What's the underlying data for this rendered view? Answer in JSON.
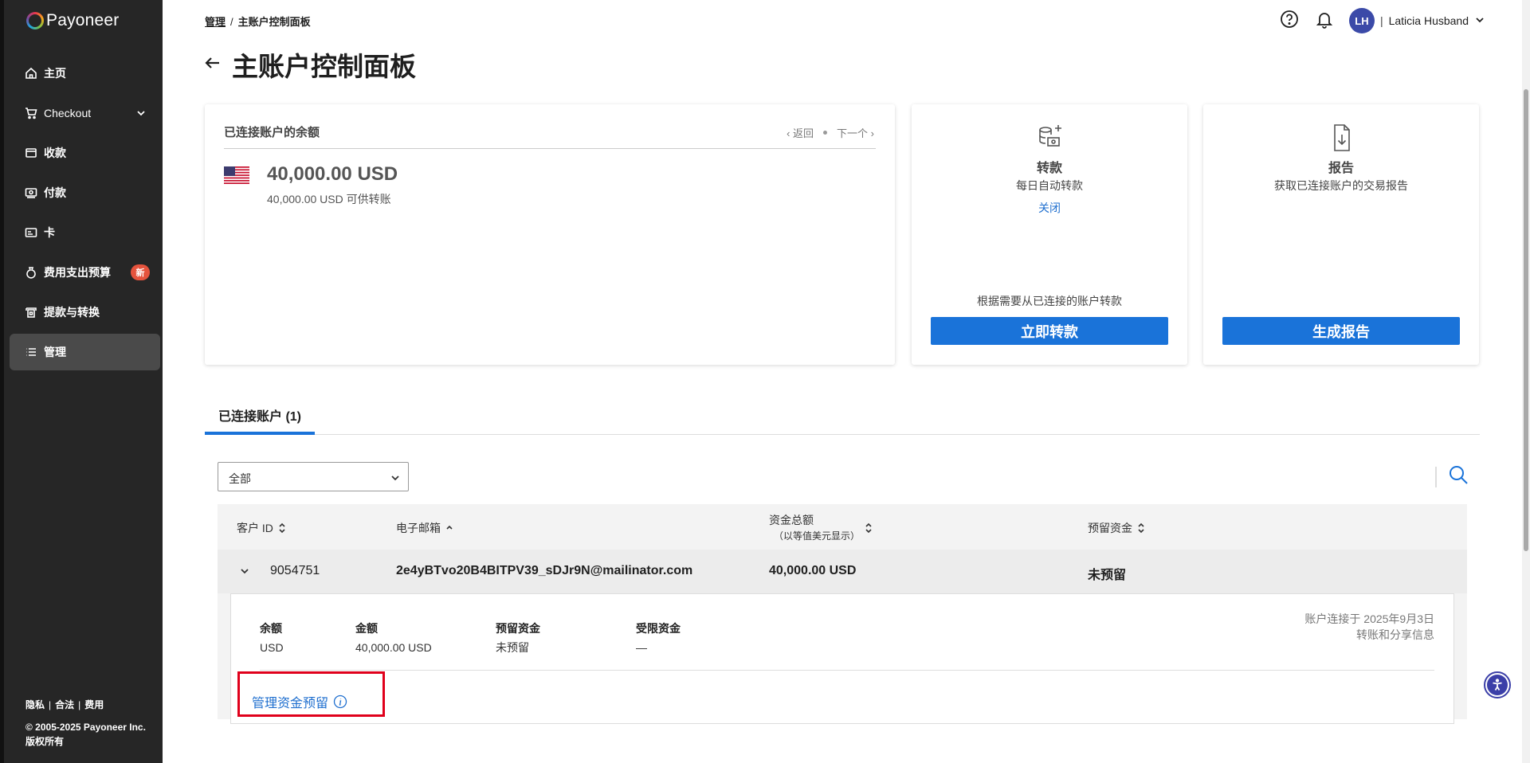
{
  "brand": {
    "name": "Payoneer"
  },
  "sidebar": {
    "items": [
      {
        "label": "主页",
        "icon": "home-icon"
      },
      {
        "label": "Checkout",
        "icon": "cart-icon",
        "expandable": true
      },
      {
        "label": "收款",
        "icon": "receive-icon"
      },
      {
        "label": "付款",
        "icon": "pay-icon"
      },
      {
        "label": "卡",
        "icon": "card-icon"
      },
      {
        "label": "费用支出预算",
        "icon": "budget-icon",
        "badge": "新"
      },
      {
        "label": "提款与转换",
        "icon": "withdraw-icon"
      },
      {
        "label": "管理",
        "icon": "list-icon",
        "active": true
      }
    ],
    "footer": {
      "links": [
        "隐私",
        "合法",
        "费用"
      ],
      "copyright": "© 2005-2025 Payoneer Inc.",
      "rights": "版权所有"
    }
  },
  "header": {
    "breadcrumb": {
      "parent": "管理",
      "current": "主账户控制面板"
    },
    "title": "主账户控制面板",
    "user": {
      "initials": "LH",
      "name": "Laticia Husband"
    }
  },
  "balance_card": {
    "title": "已连接账户的余额",
    "prev": "返回",
    "next": "下一个",
    "amount": "40,000.00 USD",
    "available": "40,000.00 USD 可供转账"
  },
  "transfer_card": {
    "title": "转款",
    "subtitle": "每日自动转款",
    "link": "关闭",
    "note": "根据需要从已连接的账户转款",
    "button": "立即转款"
  },
  "report_card": {
    "title": "报告",
    "subtitle": "获取已连接账户的交易报告",
    "button": "生成报告"
  },
  "tabs": {
    "connected": "已连接账户 (1)"
  },
  "filter": {
    "selected": "全部"
  },
  "table": {
    "headers": {
      "customer_id": "客户 ID",
      "email": "电子邮箱",
      "total_funds": "资金总额",
      "total_funds_note": "（以等值美元显示）",
      "reserved": "预留资金"
    },
    "row": {
      "customer_id": "9054751",
      "email": "2e4yBTvo20B4BITPV39_sDJr9N@mailinator.com",
      "total": "40,000.00 USD",
      "reserved": "未预留"
    },
    "detail": {
      "balance_label": "余额",
      "balance_value": "USD",
      "amount_label": "金额",
      "amount_value": "40,000.00 USD",
      "reserved_label": "预留资金",
      "reserved_value": "未预留",
      "restricted_label": "受限资金",
      "restricted_value": "—",
      "connected_on": "账户连接于 2025年9月3日",
      "sharing_info": "转账和分享信息",
      "manage_link": "管理资金预留"
    }
  },
  "colors": {
    "primary": "#1a73d9",
    "sidebar": "#262626",
    "highlight": "#e0001b",
    "badge": "#e5533d"
  }
}
